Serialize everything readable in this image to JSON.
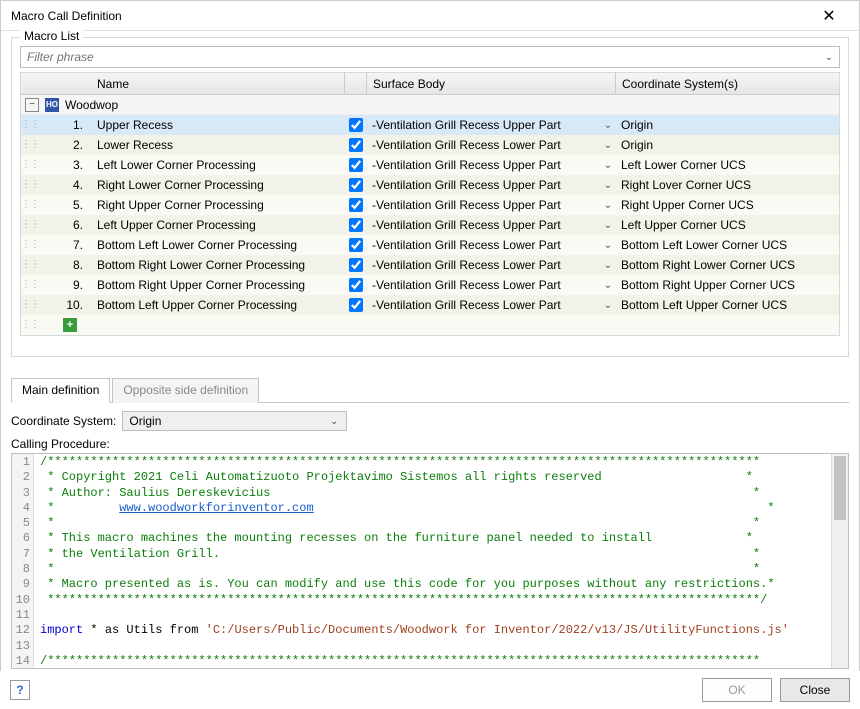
{
  "window": {
    "title": "Macro Call Definition"
  },
  "macroList": {
    "panelLabel": "Macro List",
    "filterPlaceholder": "Filter phrase",
    "headers": {
      "name": "Name",
      "surface": "Surface Body",
      "cs": "Coordinate System(s)"
    },
    "groupName": "Woodwop",
    "rows": [
      {
        "num": "1.",
        "name": "Upper Recess",
        "checked": true,
        "surface": "-Ventilation Grill Recess Upper Part",
        "cs": "Origin",
        "selected": true
      },
      {
        "num": "2.",
        "name": "Lower Recess",
        "checked": true,
        "surface": "-Ventilation Grill Recess Lower Part",
        "cs": "Origin"
      },
      {
        "num": "3.",
        "name": "Left Lower Corner Processing",
        "checked": true,
        "surface": "-Ventilation Grill Recess Upper Part",
        "cs": "Left Lower Corner UCS"
      },
      {
        "num": "4.",
        "name": "Right Lower Corner Processing",
        "checked": true,
        "surface": "-Ventilation Grill Recess Upper Part",
        "cs": "Right Lover Corner UCS"
      },
      {
        "num": "5.",
        "name": "Right Upper Corner Processing",
        "checked": true,
        "surface": "-Ventilation Grill Recess Upper Part",
        "cs": "Right Upper Corner UCS"
      },
      {
        "num": "6.",
        "name": "Left Upper Corner Processing",
        "checked": true,
        "surface": "-Ventilation Grill Recess Upper Part",
        "cs": "Left Upper Corner UCS"
      },
      {
        "num": "7.",
        "name": "Bottom Left Lower Corner Processing",
        "checked": true,
        "surface": "-Ventilation Grill Recess Lower Part",
        "cs": "Bottom Left Lower Corner UCS"
      },
      {
        "num": "8.",
        "name": "Bottom Right Lower Corner Processing",
        "checked": true,
        "surface": "-Ventilation Grill Recess Lower Part",
        "cs": "Bottom Right Lower Corner UCS"
      },
      {
        "num": "9.",
        "name": "Bottom Right Upper Corner Processing",
        "checked": true,
        "surface": "-Ventilation Grill Recess Lower Part",
        "cs": "Bottom Right Upper Corner UCS"
      },
      {
        "num": "10.",
        "name": "Bottom Left Upper Corner Processing",
        "checked": true,
        "surface": "-Ventilation Grill Recess Lower Part",
        "cs": "Bottom Left Upper Corner UCS"
      }
    ]
  },
  "tabs": {
    "main": "Main definition",
    "opposite": "Opposite side definition"
  },
  "coordSystem": {
    "label": "Coordinate System:",
    "value": "Origin"
  },
  "callingProcedure": {
    "label": "Calling Procedure:"
  },
  "code": {
    "starsOpen": "/***************************************************************************************************",
    "copyright": " * Copyright 2021 Celi Automatizuoto Projektavimo Sistemos all rights reserved                    *",
    "author": " * Author: Saulius Dereskevicius                                                                   *",
    "linkPrefix": " *         ",
    "linkText": "www.woodworkforinventor.com",
    "linkSuffix": "                                                               *",
    "blank": " *                                                                                                 *",
    "desc1": " * This macro machines the mounting recesses on the furniture panel needed to install             *",
    "desc2": " * the Ventilation Grill.                                                                          *",
    "note": " * Macro presented as is. You can modify and use this code for you purposes without any restrictions.*",
    "starsClose": " ***************************************************************************************************/",
    "importKw": "import",
    "importMid": " * as Utils from ",
    "importPath": "'C:/Users/Public/Documents/Woodwork for Inventor/2022/v13/JS/UtilityFunctions.js'",
    "starsOpen2": "/***************************************************************************************************"
  },
  "footer": {
    "ok": "OK",
    "close": "Close"
  }
}
